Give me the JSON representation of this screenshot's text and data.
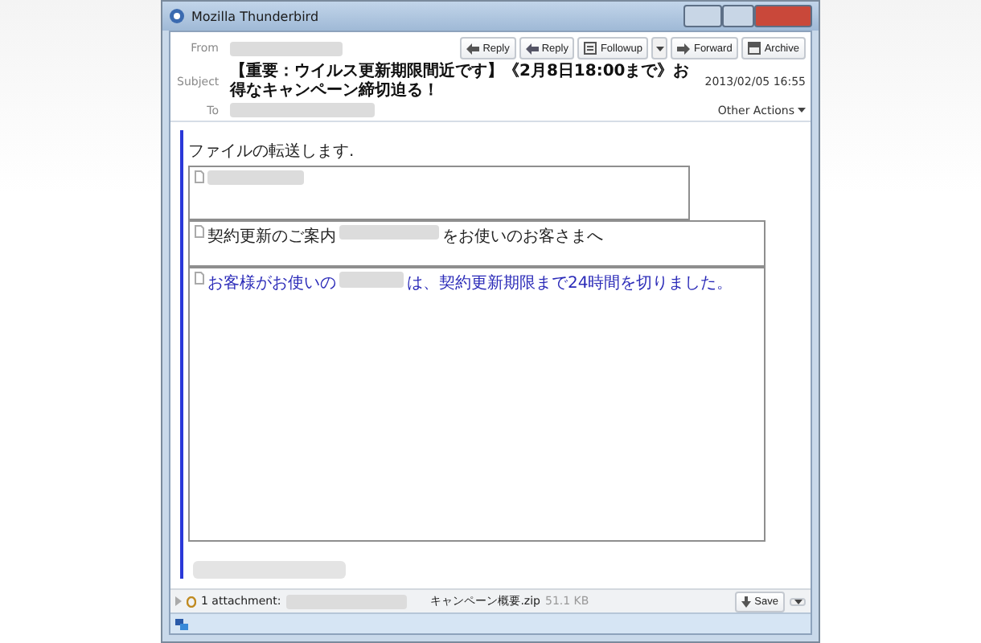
{
  "window": {
    "title": "Mozilla Thunderbird"
  },
  "header": {
    "from_label": "From",
    "subject_label": "Subject",
    "subject": "【重要：ウイルス更新期限間近です】《2月8日18:00まで》お得なキャンペーン締切迫る！",
    "to_label": "To",
    "date": "2013/02/05 16:55",
    "other_actions": "Other Actions",
    "buttons": [
      {
        "kind": "reply",
        "label": "Reply"
      },
      {
        "kind": "reply-all",
        "label": "Reply"
      },
      {
        "kind": "followup",
        "label": "Followup"
      },
      {
        "kind": "forward",
        "label": "Forward"
      },
      {
        "kind": "archive",
        "label": "Archive"
      }
    ]
  },
  "body": {
    "intro": "ファイルの転送します.",
    "frames": [
      {
        "kind": "blank"
      },
      {
        "kind": "plain",
        "text_before": "契約更新のご案内",
        "text_after": "をお使いのお客さまへ"
      },
      {
        "kind": "link",
        "text_before": "お客様がお使いの",
        "text_after": "は、契約更新期限まで24時間を切りました。"
      }
    ]
  },
  "attachment": {
    "count": "1 attachment:",
    "filename": "キャンペーン概要.zip",
    "size": "51.1 KB",
    "save": "Save"
  }
}
